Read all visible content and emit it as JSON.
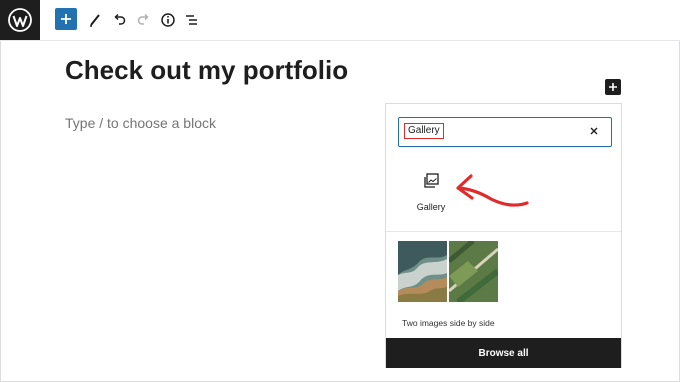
{
  "colors": {
    "accent": "#2271b1",
    "dark": "#1e1e1e",
    "annotation_red": "#e02b2b"
  },
  "toolbar": {
    "icons": [
      "wordpress-logo-icon",
      "add-block-icon",
      "pen-tool-icon",
      "undo-icon",
      "redo-icon",
      "info-icon",
      "list-view-icon"
    ]
  },
  "editor": {
    "title": "Check out my portfolio",
    "placeholder": "Type / to choose a block"
  },
  "inserter": {
    "search_value": "Gallery",
    "result_label": "Gallery",
    "pattern_label": "Two images side by side",
    "browse_label": "Browse all"
  }
}
